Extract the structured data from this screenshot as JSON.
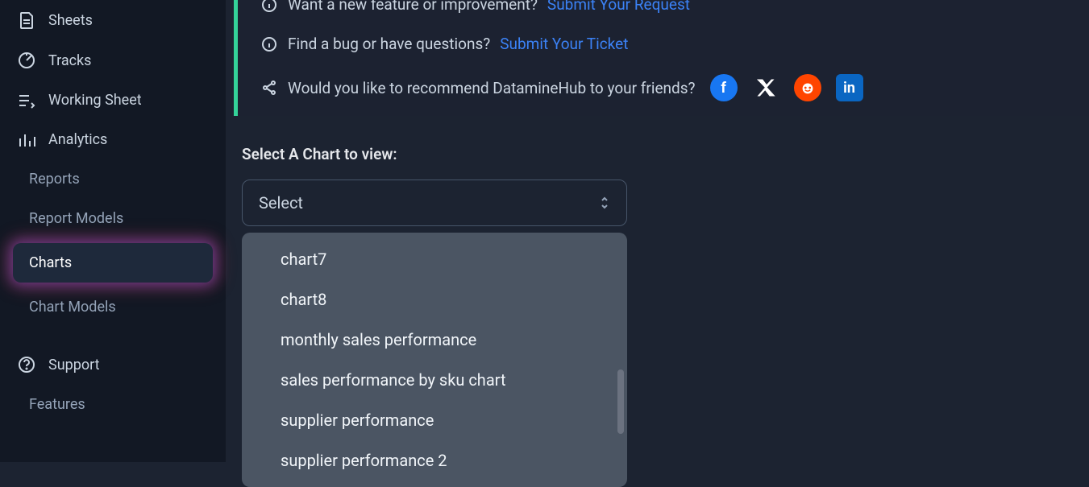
{
  "sidebar": {
    "items": [
      {
        "label": "Sheets",
        "icon": "file-icon"
      },
      {
        "label": "Tracks",
        "icon": "target-icon"
      },
      {
        "label": "Working Sheet",
        "icon": "edit-icon"
      },
      {
        "label": "Analytics",
        "icon": "bar-chart-icon"
      }
    ],
    "subitems": [
      {
        "label": "Reports"
      },
      {
        "label": "Report Models"
      },
      {
        "label": "Charts",
        "active": true
      },
      {
        "label": "Chart Models"
      }
    ],
    "bottom_items": [
      {
        "label": "Support",
        "icon": "help-icon"
      },
      {
        "label": "Features"
      }
    ]
  },
  "info_panel": {
    "line1_text": "Want a new feature or improvement?",
    "line1_link": "Submit Your Request",
    "line2_text": "Find a bug or have questions?",
    "line2_link": "Submit Your Ticket",
    "line3_text": "Would you like to recommend DatamineHub to your friends?"
  },
  "select_section": {
    "label": "Select A Chart to view:",
    "placeholder": "Select"
  },
  "dropdown": {
    "options": [
      "chart7",
      "chart8",
      "monthly sales performance",
      "sales performance by sku chart",
      "supplier performance",
      "supplier performance 2"
    ]
  }
}
